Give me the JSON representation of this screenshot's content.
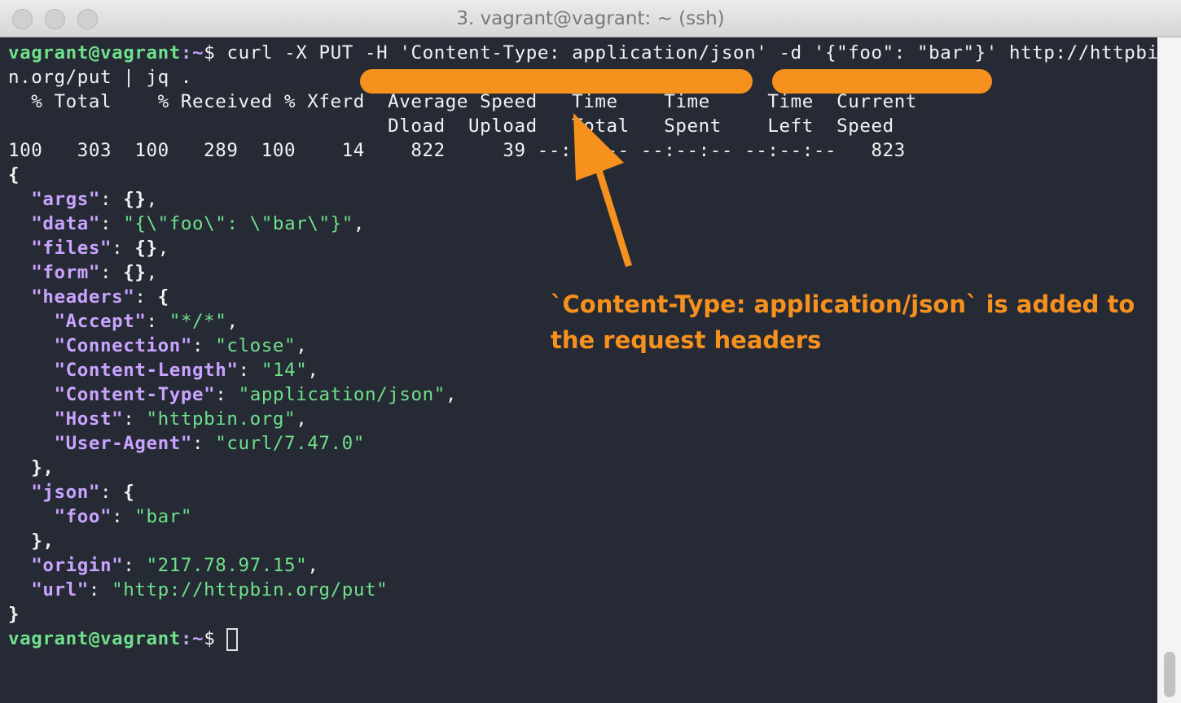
{
  "window": {
    "title": "3. vagrant@vagrant: ~ (ssh)"
  },
  "prompt": {
    "user": "vagrant@vagrant",
    "sep": ":",
    "path": "~",
    "symbol": "$"
  },
  "command": {
    "line1": " curl -X PUT -H 'Content-Type: application/json' -d '{\"foo\": \"bar\"}' http://httpbi",
    "line2": "n.org/put | jq ."
  },
  "progress": {
    "header1": "  % Total    % Received % Xferd  Average Speed   Time    Time     Time  Current",
    "header2": "                                 Dload  Upload   Total   Spent    Left  Speed",
    "row": "100   303  100   289  100    14    822     39 --:--:-- --:--:-- --:--:--   823"
  },
  "json_output": {
    "args": "{}",
    "data": "\"{\\\"foo\\\": \\\"bar\\\"}\"",
    "files": "{}",
    "form": "{}",
    "headers": {
      "Accept": "\"*/*\"",
      "Connection": "\"close\"",
      "Content-Length": "\"14\"",
      "Content-Type": "\"application/json\"",
      "Host": "\"httpbin.org\"",
      "User-Agent": "\"curl/7.47.0\""
    },
    "json_foo": "\"bar\"",
    "origin": "\"217.78.97.15\"",
    "url": "\"http://httpbin.org/put\""
  },
  "annotation": {
    "line1": "`Content-Type: application/json` is added to",
    "line2": "the request headers",
    "color": "#f7911e"
  }
}
